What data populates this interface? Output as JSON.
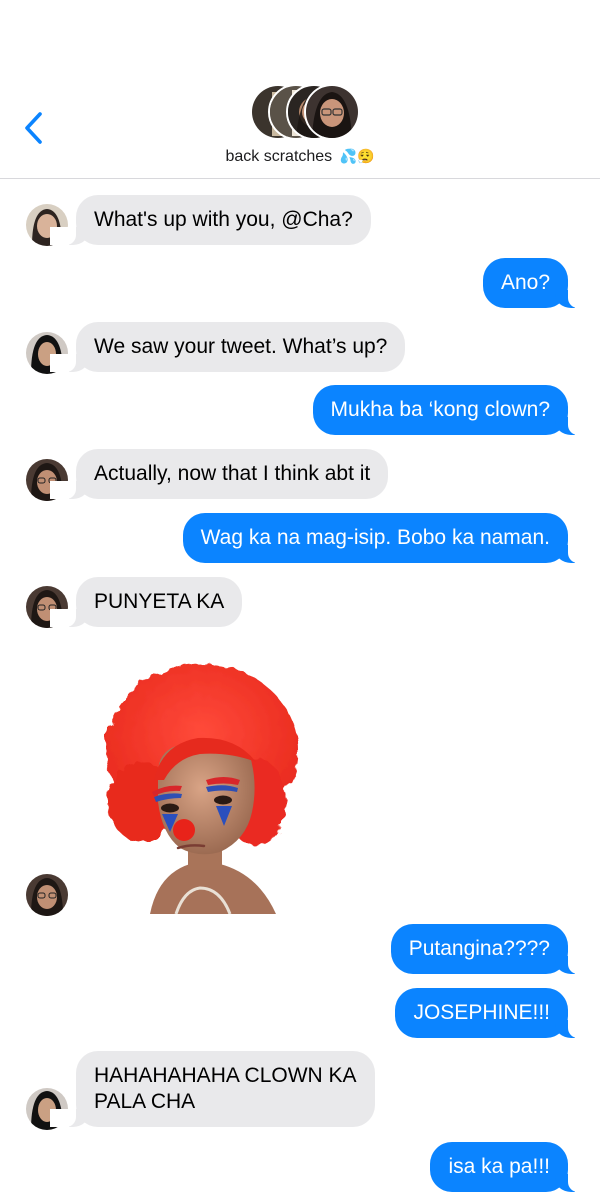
{
  "header": {
    "group_name": "back scratches",
    "group_emoji": "💦😮‍💨"
  },
  "messages": [
    {
      "side": "in",
      "text": "What's up with you, @Cha?"
    },
    {
      "side": "out",
      "text": "Ano?"
    },
    {
      "side": "in",
      "text": "We saw your tweet. What’s up?"
    },
    {
      "side": "out",
      "text": "Mukha ba ‘kong clown?"
    },
    {
      "side": "in",
      "text": "Actually, now that I think abt it"
    },
    {
      "side": "out",
      "text": "Wag ka na mag-isip. Bobo ka naman."
    },
    {
      "side": "in",
      "text": "PUNYETA KA"
    },
    {
      "side": "out",
      "text": "Putangina????"
    },
    {
      "side": "out",
      "text": "JOSEPHINE!!!"
    },
    {
      "side": "in",
      "text_lines": [
        "HAHAHAHAHA CLOWN KA",
        "PALA CHA"
      ]
    },
    {
      "side": "out",
      "text": "isa ka pa!!!"
    }
  ],
  "colors": {
    "outgoing_bubble": "#0b84ff",
    "incoming_bubble": "#e9e9eb",
    "accent": "#0b84ff"
  },
  "icons": {
    "back": "chevron-left-icon"
  }
}
